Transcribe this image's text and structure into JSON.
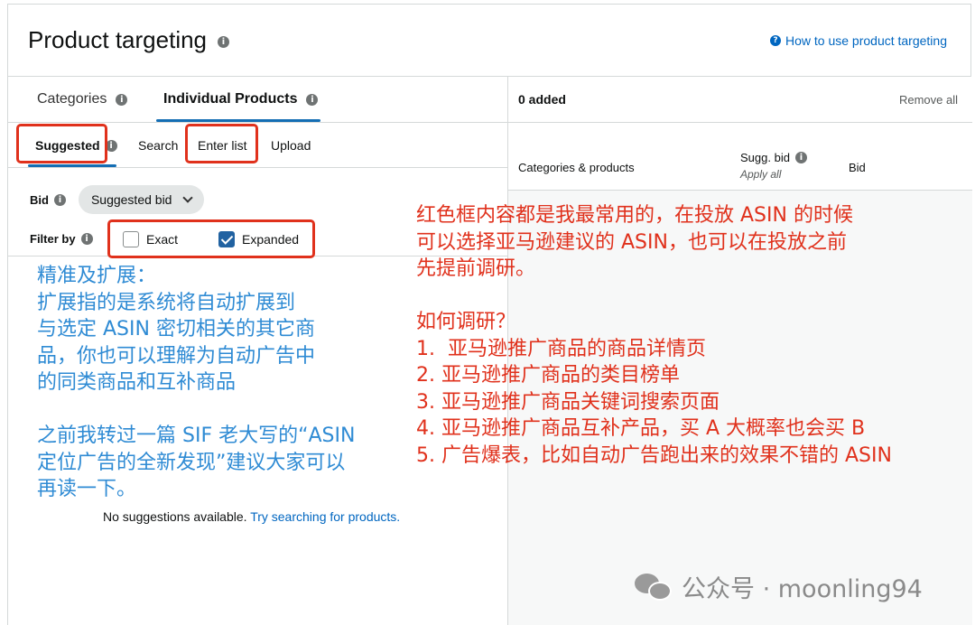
{
  "header": {
    "title": "Product targeting",
    "help_link": "How to use product targeting"
  },
  "main_tabs": [
    {
      "label": "Categories"
    },
    {
      "label": "Individual Products"
    }
  ],
  "sub_tabs": [
    {
      "label": "Suggested"
    },
    {
      "label": "Search"
    },
    {
      "label": "Enter list"
    },
    {
      "label": "Upload"
    }
  ],
  "bid": {
    "label": "Bid",
    "selected": "Suggested bid"
  },
  "filter": {
    "label": "Filter by",
    "options": [
      {
        "label": "Exact",
        "checked": false
      },
      {
        "label": "Expanded",
        "checked": true
      }
    ]
  },
  "empty_state": {
    "text": "No suggestions available.",
    "link": "Try searching for products."
  },
  "right_panel": {
    "added": "0 added",
    "remove_all": "Remove all",
    "columns": {
      "categories": "Categories & products",
      "sugg_bid": "Sugg. bid",
      "apply_all": "Apply all",
      "bid": "Bid"
    }
  },
  "annotations": {
    "blue_note": "精准及扩展：\n扩展指的是系统将自动扩展到\n与选定 ASIN 密切相关的其它商\n品，你也可以理解为自动广告中\n的同类商品和互补商品\n\n之前我转过一篇 SIF 老大写的“ASIN\n定位广告的全新发现”建议大家可以\n再读一下。",
    "red_note": "红色框内容都是我最常用的，在投放 ASIN 的时候\n可以选择亚马逊建议的 ASIN，也可以在投放之前\n先提前调研。\n\n如何调研？\n1.  亚马逊推广商品的商品详情页\n2. 亚马逊推广商品的类目榜单\n3. 亚马逊推广商品关键词搜索页面\n4. 亚马逊推广商品互补产品，买 A 大概率也会买 B\n5. 广告爆表，比如自动广告跑出来的效果不错的 ASIN",
    "color_red": "#e0311c",
    "color_blue": "#2f8bd4"
  },
  "watermark": {
    "text": "公众号 · moonling94"
  },
  "icons": {
    "info": "info-icon",
    "help": "help-icon",
    "chevron": "chevron-down-icon",
    "wechat": "wechat-icon"
  }
}
